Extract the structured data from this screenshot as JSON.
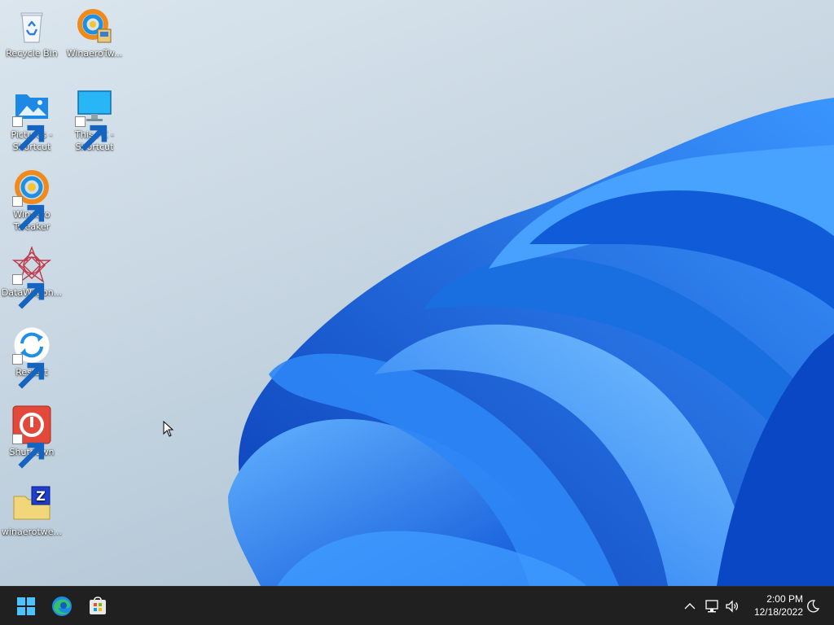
{
  "desktop": {
    "icons": [
      {
        "label": "Recycle Bin",
        "icon": "recycle-bin-icon"
      },
      {
        "label": "WinaeroTw...",
        "icon": "winaero-tweaker-setup-icon"
      },
      {
        "label": "Pictures -\nShortcut",
        "icon": "pictures-folder-icon"
      },
      {
        "label": "This PC -\nShortcut",
        "icon": "monitor-icon"
      },
      {
        "label": "Winaero\nTweaker",
        "icon": "winaero-tweaker-icon"
      },
      {
        "label": "DataWagon...",
        "icon": "datawagon-icon"
      },
      {
        "label": "Restart",
        "icon": "restart-icon"
      },
      {
        "label": "Shutdown",
        "icon": "power-icon"
      },
      {
        "label": "winaerotwe...",
        "icon": "zip-archive-icon"
      }
    ]
  },
  "taskbar": {
    "pinned": [
      "windows-start-icon",
      "edge-browser-icon",
      "microsoft-store-icon"
    ],
    "tray": [
      "chevron-up-icon",
      "network-icon",
      "volume-icon",
      "moon-icon"
    ],
    "clock": {
      "time": "2:00 PM",
      "date": "12/18/2022"
    }
  },
  "colors": {
    "taskbar": "#202020",
    "accent": "#1a6fe0"
  }
}
